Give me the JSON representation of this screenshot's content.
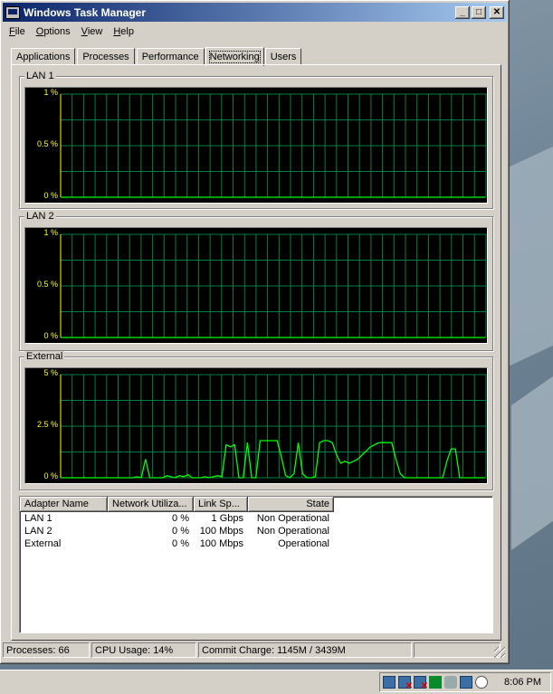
{
  "window": {
    "title": "Windows Task Manager",
    "minimize": "_",
    "maximize": "□",
    "close": "✕"
  },
  "menu": [
    {
      "label": "File",
      "accel": "F",
      "rest": "ile"
    },
    {
      "label": "Options",
      "accel": "O",
      "rest": "ptions"
    },
    {
      "label": "View",
      "accel": "V",
      "rest": "iew"
    },
    {
      "label": "Help",
      "accel": "H",
      "rest": "elp"
    }
  ],
  "tabs": [
    "Applications",
    "Processes",
    "Performance",
    "Networking",
    "Users"
  ],
  "active_tab": "Networking",
  "graphs": [
    {
      "label": "LAN 1",
      "y_labels": [
        "1 %",
        "0.5 %",
        "0 %"
      ],
      "max": 1,
      "series": [
        0,
        0,
        0,
        0,
        0,
        0,
        0,
        0,
        0,
        0,
        0,
        0,
        0,
        0,
        0,
        0,
        0,
        0,
        0,
        0,
        0,
        0,
        0,
        0,
        0,
        0,
        0,
        0,
        0,
        0,
        0,
        0,
        0,
        0,
        0,
        0,
        0,
        0,
        0,
        0,
        0,
        0,
        0,
        0,
        0,
        0,
        0,
        0,
        0,
        0,
        0,
        0,
        0,
        0,
        0,
        0,
        0,
        0,
        0,
        0
      ]
    },
    {
      "label": "LAN 2",
      "y_labels": [
        "1 %",
        "0.5 %",
        "0 %"
      ],
      "max": 1,
      "series": [
        0,
        0,
        0,
        0,
        0,
        0,
        0,
        0,
        0,
        0,
        0,
        0,
        0,
        0,
        0,
        0,
        0,
        0,
        0,
        0,
        0,
        0,
        0,
        0,
        0,
        0,
        0,
        0,
        0,
        0,
        0,
        0,
        0,
        0,
        0,
        0,
        0,
        0,
        0,
        0,
        0,
        0,
        0,
        0,
        0,
        0,
        0,
        0,
        0,
        0,
        0,
        0,
        0,
        0,
        0,
        0,
        0,
        0,
        0,
        0
      ]
    },
    {
      "label": "External",
      "y_labels": [
        "5 %",
        "2.5 %",
        "0 %"
      ],
      "max": 5,
      "series": [
        0,
        0,
        0,
        0,
        0,
        0,
        0,
        0,
        0,
        0,
        0,
        0,
        0,
        0,
        0,
        0,
        0,
        0,
        0.05,
        0,
        0.9,
        0,
        0,
        0,
        0,
        0.1,
        0.05,
        0,
        0.1,
        0.05,
        0.15,
        0,
        0,
        0,
        0.05,
        0,
        0.05,
        0.1,
        0.05,
        1.6,
        1.5,
        1.6,
        0,
        0,
        1.7,
        0,
        0,
        1.8,
        1.8,
        1.8,
        1.8,
        1.8,
        1.0,
        0.1,
        0,
        0.2,
        1.7,
        0.2,
        0,
        0,
        0.05,
        1.7,
        1.8,
        1.8,
        1.7,
        1.1,
        0.7,
        0.8,
        0.7,
        0.8,
        0.9,
        1.1,
        1.3,
        1.5,
        1.6,
        1.7,
        1.7,
        1.7,
        1.7,
        0.9,
        0.2,
        0,
        0,
        0,
        0,
        0,
        0,
        0,
        0,
        0,
        0,
        0.8,
        1.4,
        1.4,
        0,
        0,
        0,
        0,
        0,
        0,
        0
      ]
    }
  ],
  "adapters": {
    "headers": [
      "Adapter Name",
      "Network Utiliza...",
      "Link Sp...",
      "State"
    ],
    "rows": [
      [
        "LAN 1",
        "0 %",
        "1 Gbps",
        "Non Operational"
      ],
      [
        "LAN 2",
        "0 %",
        "100 Mbps",
        "Non Operational"
      ],
      [
        "External",
        "0 %",
        "100 Mbps",
        "Operational"
      ]
    ]
  },
  "status": {
    "processes": "Processes: 66",
    "cpu": "CPU Usage: 14%",
    "commit": "Commit Charge: 1145M / 3439M"
  },
  "taskbar": {
    "clock": "8:06 PM"
  },
  "colors": {
    "grid": "#008040",
    "line": "#00ff00",
    "axis_label": "#ffff00",
    "title_from": "#0a246a",
    "title_to": "#a6caf0"
  }
}
